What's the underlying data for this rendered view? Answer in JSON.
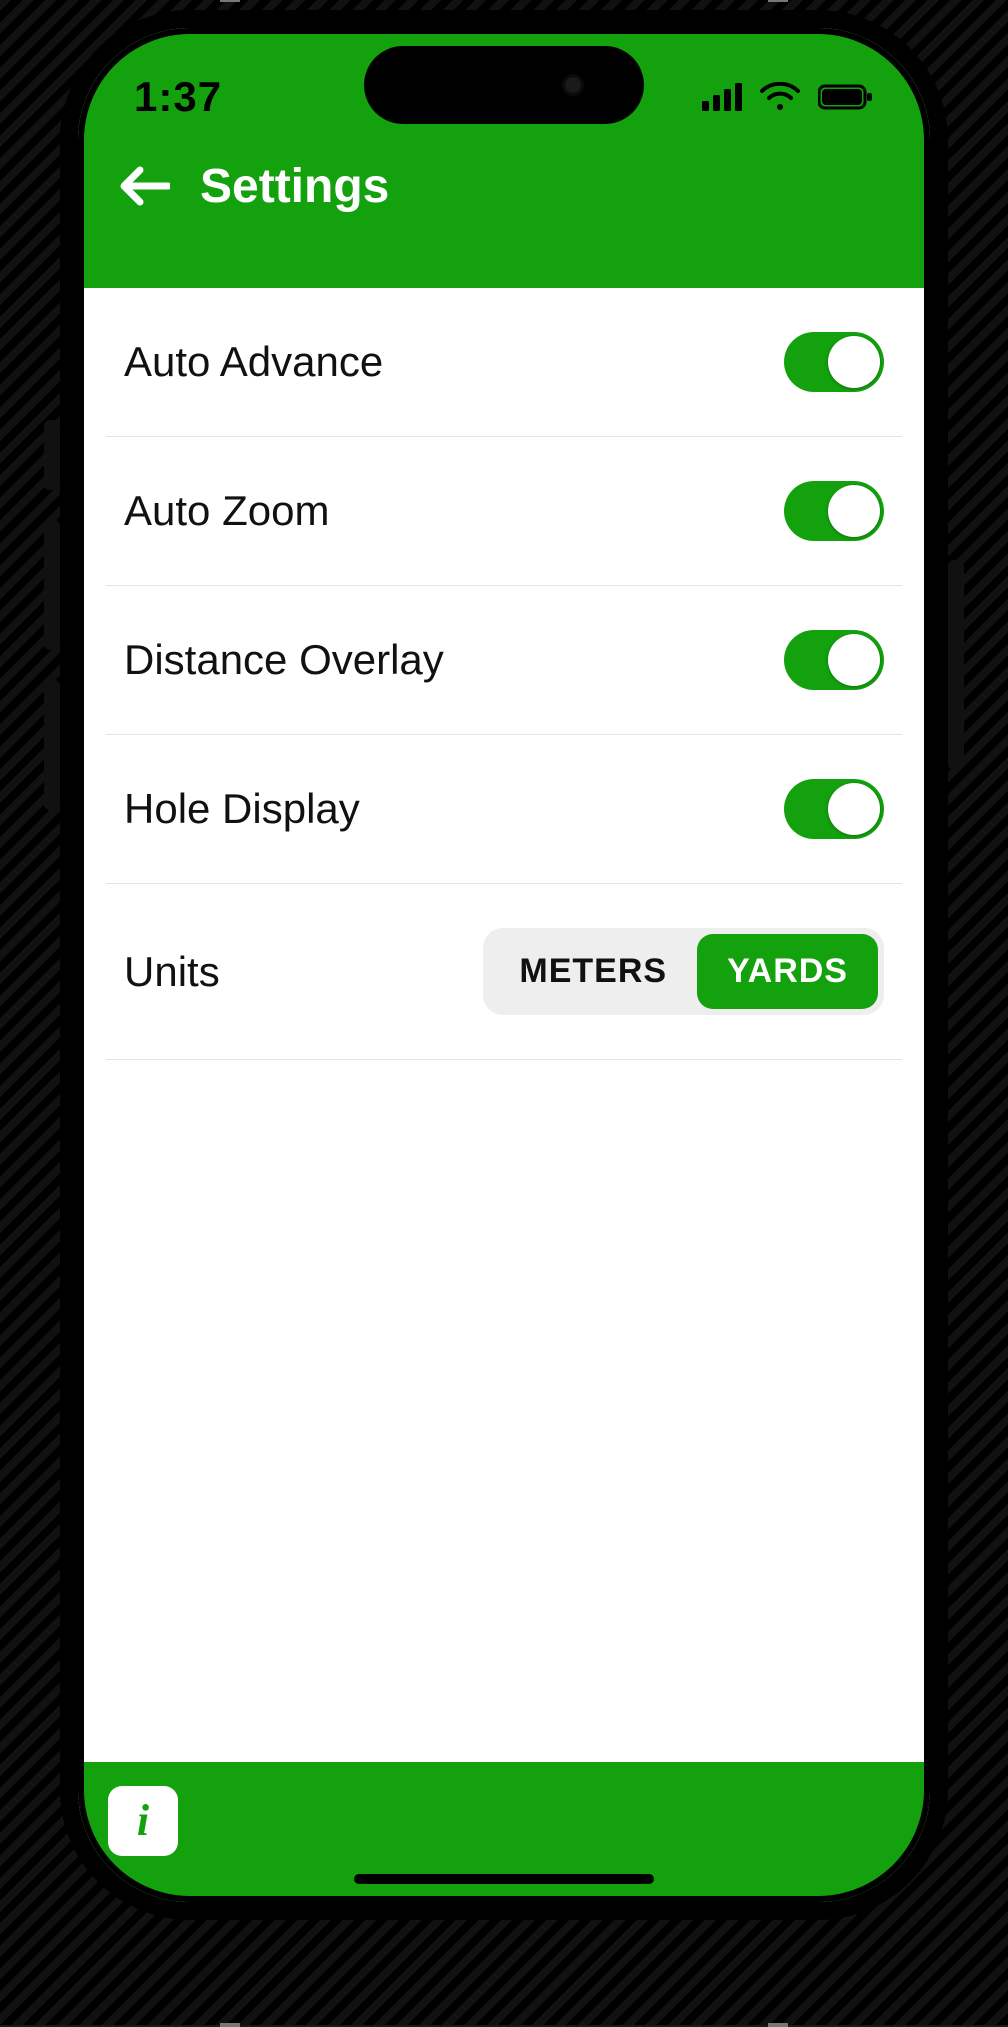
{
  "status": {
    "time": "1:37"
  },
  "nav": {
    "title": "Settings"
  },
  "rows": [
    {
      "label": "Auto Advance",
      "on": true
    },
    {
      "label": "Auto Zoom",
      "on": true
    },
    {
      "label": "Distance Overlay",
      "on": true
    },
    {
      "label": "Hole Display",
      "on": true
    }
  ],
  "units": {
    "label": "Units",
    "options": [
      "METERS",
      "YARDS"
    ],
    "selected": "YARDS"
  },
  "colors": {
    "accent": "#13a10e"
  }
}
